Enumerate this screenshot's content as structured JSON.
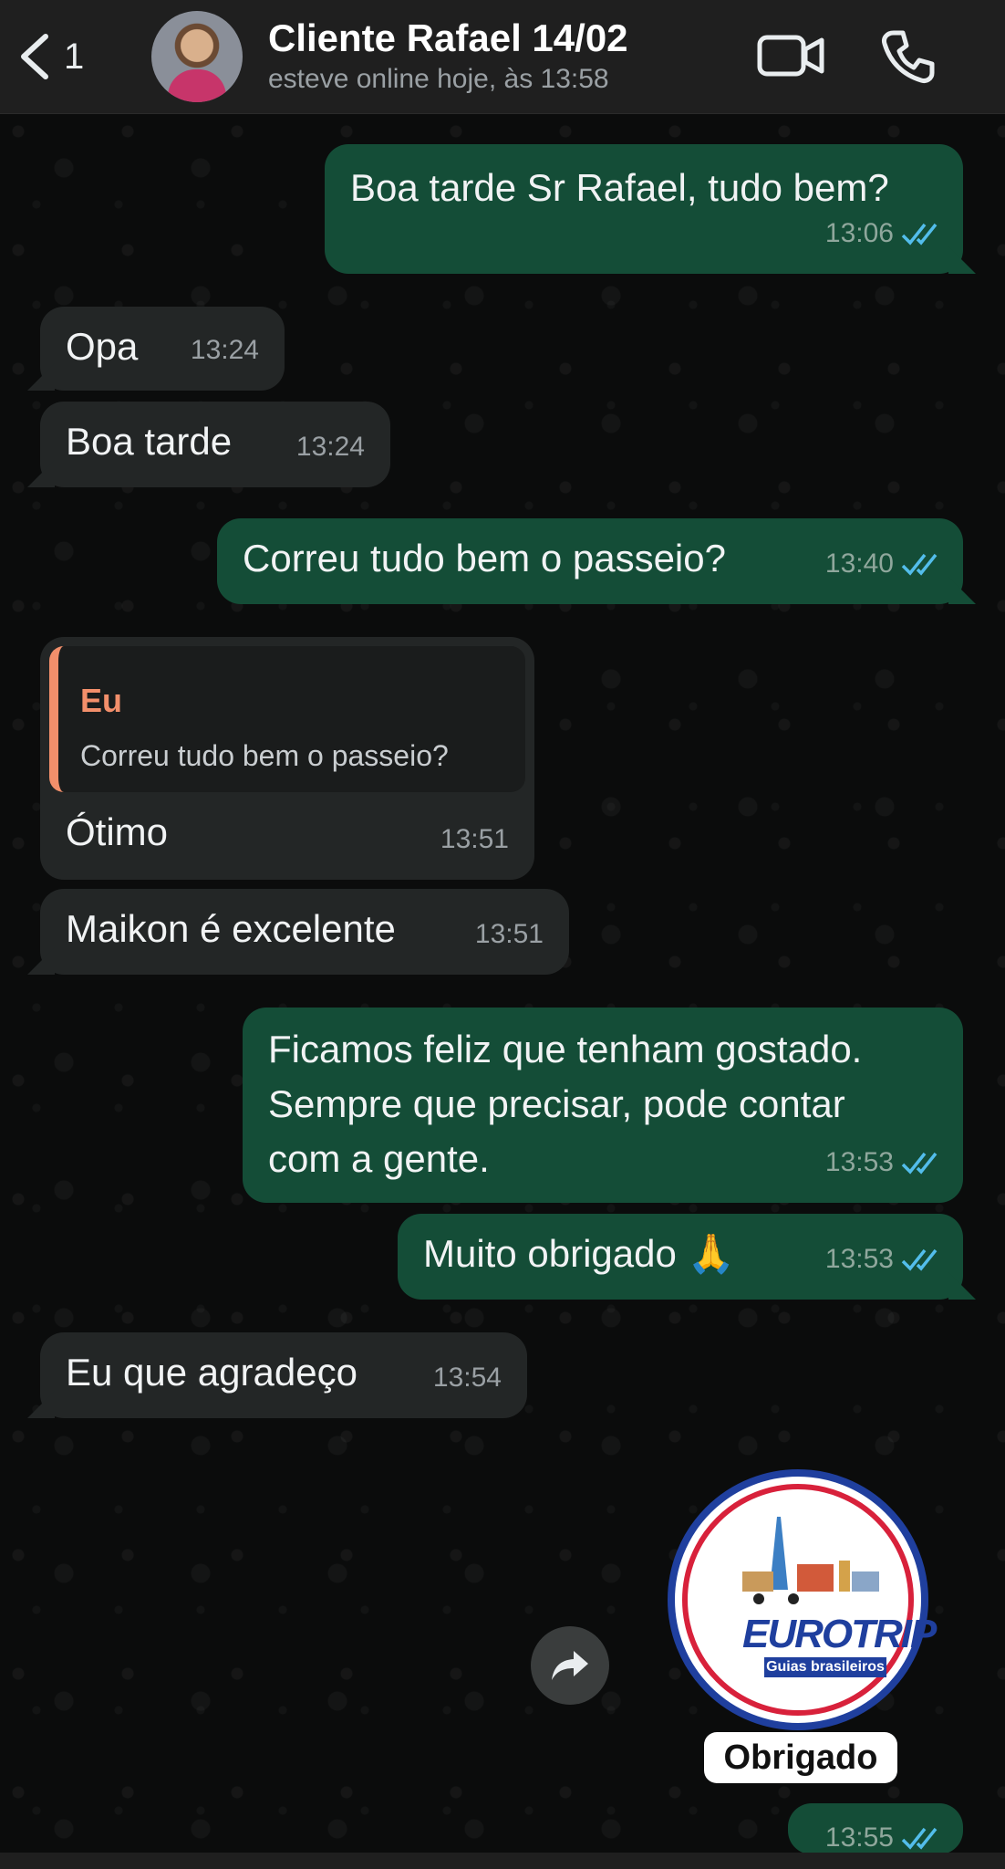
{
  "header": {
    "back_count": "1",
    "contact_name": "Cliente Rafael 14/02",
    "status": "esteve online hoje, às 13:58"
  },
  "messages": [
    {
      "text": "Boa tarde Sr Rafael, tudo bem?",
      "time": "13:06"
    },
    {
      "text": "Opa",
      "time": "13:24"
    },
    {
      "text": "Boa tarde",
      "time": "13:24"
    },
    {
      "text": "Correu tudo bem o passeio?",
      "time": "13:40"
    },
    {
      "quote_author": "Eu",
      "quote_text": "Correu tudo bem o passeio?",
      "text": "Ótimo",
      "time": "13:51"
    },
    {
      "text": "Maikon é excelente",
      "time": "13:51"
    },
    {
      "lines": [
        "Ficamos feliz que tenham gostado.",
        "Sempre que precisar, pode contar",
        "com a gente."
      ],
      "time": "13:53"
    },
    {
      "text": "Muito obrigado 🙏",
      "time": "13:53"
    },
    {
      "text": "Eu que agradeço",
      "time": "13:54"
    }
  ],
  "sticker": {
    "logo_text": "EUROTRIP",
    "logo_sub": "Guias brasileiros",
    "label": "Obrigado",
    "time": "13:55"
  },
  "colors": {
    "outgoing_bubble": "#144d37",
    "incoming_bubble": "#232626",
    "read_ticks": "#53bdeb",
    "quote_accent": "#f28f6b"
  }
}
